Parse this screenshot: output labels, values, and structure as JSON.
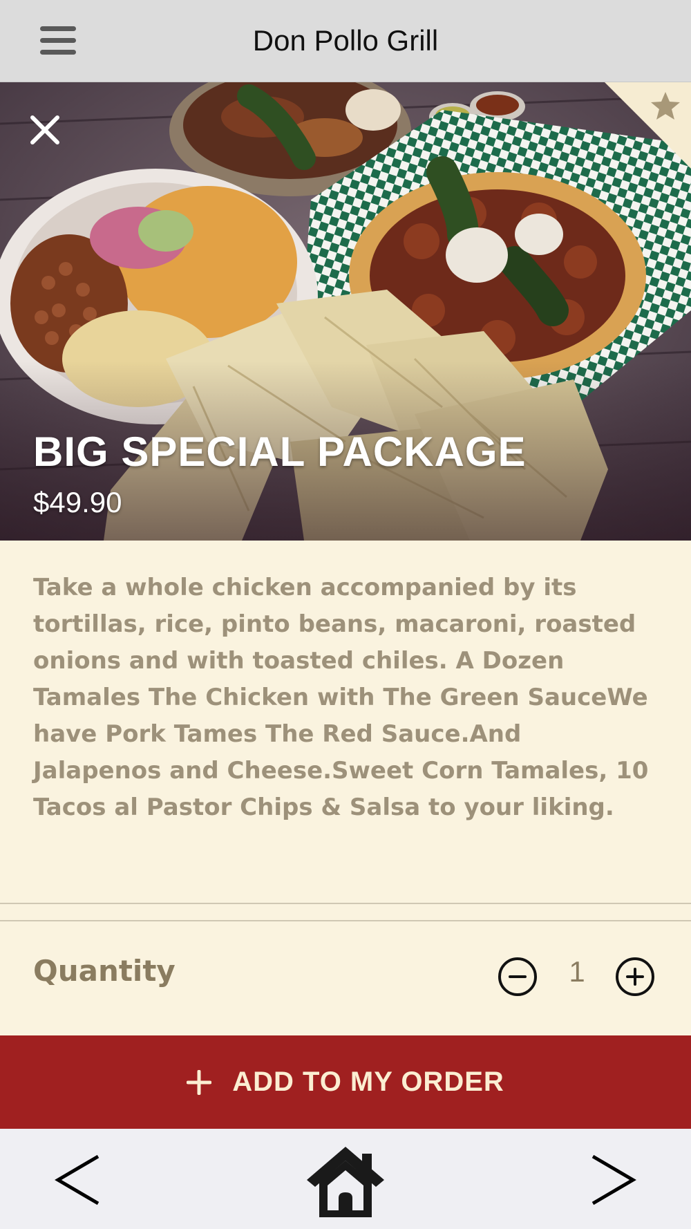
{
  "header": {
    "title": "Don Pollo Grill",
    "menu_icon": "hamburger-menu-icon"
  },
  "hero": {
    "close_icon": "close-icon",
    "favorite_icon": "star-icon",
    "image_description": "platter of chicken, rice, pinto beans, macaroni, tacos and tamales",
    "item_name": "BIG SPECIAL PACKAGE",
    "price": "$49.90"
  },
  "description": "Take a whole chicken accompanied by its tortillas, rice, pinto beans, macaroni, roasted onions and with toasted chiles. A Dozen Tamales The Chicken with The Green SauceWe have Pork Tames The Red Sauce.And Jalapenos and Cheese.Sweet Corn Tamales, 10 Tacos al Pastor Chips & Salsa to your liking.",
  "quantity": {
    "label": "Quantity",
    "value": "1",
    "decrement_icon": "minus-circle-icon",
    "increment_icon": "plus-circle-icon"
  },
  "add_button": {
    "label": "ADD TO MY ORDER",
    "icon": "plus-icon"
  },
  "bottom_nav": {
    "back_icon": "chevron-left-icon",
    "home_icon": "home-icon",
    "forward_icon": "chevron-right-icon"
  },
  "colors": {
    "accent": "#a02020",
    "background": "#faf3df",
    "text_muted": "#9d917a",
    "favorite": "#a89878"
  }
}
